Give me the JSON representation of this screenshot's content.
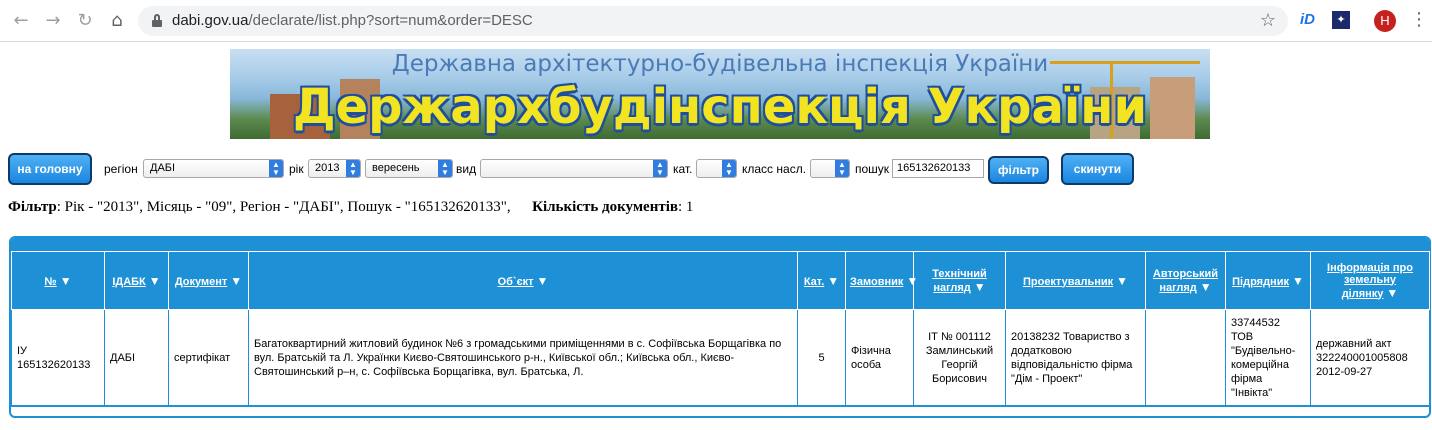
{
  "browser": {
    "url_host": "dabi.gov.ua",
    "url_path": "/declarate/list.php?sort=num&order=DESC",
    "ext1_label": "iD",
    "avatar_letter": "H"
  },
  "banner": {
    "subtitle": "Державна архітектурно-будівельна інспекція України",
    "title": "Держархбудінспекція України"
  },
  "filter_form": {
    "home_button": "на головну",
    "region_label": "регіон",
    "region_value": "ДАБІ",
    "year_label": "рік",
    "year_value": "2013",
    "month_value": "вересень",
    "type_label": "вид",
    "type_value": "",
    "cat_label": "кат.",
    "cat_value": "",
    "class_label": "класс насл.",
    "class_value": "",
    "search_label": "пошук",
    "search_value": "165132620133",
    "filter_button": "фільтр",
    "reset_button": "скинути"
  },
  "summary": {
    "filter_label": "Фільтр",
    "filter_text": ": Рік - \"2013\", Місяць - \"09\", Регіон - \"ДАБІ\", Пошук - \"165132620133\",",
    "count_label": "Кількість документів",
    "count_value": ": 1"
  },
  "table": {
    "headers": [
      {
        "label": "№",
        "sortable": true
      },
      {
        "label": "ІДАБК",
        "sortable": true
      },
      {
        "label": "Документ",
        "sortable": true
      },
      {
        "label": "Об`єкт",
        "sortable": true
      },
      {
        "label": "Кат.",
        "sortable": true
      },
      {
        "label": "Замовник",
        "sortable": true
      },
      {
        "label": "Технічний нагляд",
        "sortable": true
      },
      {
        "label": "Проектувальник",
        "sortable": true
      },
      {
        "label": "Авторський нагляд",
        "sortable": true
      },
      {
        "label": "Підрядник",
        "sortable": true
      },
      {
        "label": "Інформація про земельну ділянку",
        "sortable": true
      }
    ],
    "rows": [
      {
        "num": "ІУ 165132620133",
        "idabk": "ДАБІ",
        "document": "сертифікат",
        "object": "Багатоквартирний житловий будинок №6 з громадськими приміщеннями в с. Софіївська Борщагівка по вул. Братській та Л. Українки Києво-Святошинського р-н., Київської обл.; Київська обл., Києво-Святошинський р–н, с. Софіївська Борщагівка, вул. Братська, Л.",
        "category": "5",
        "customer": "Фізична особа",
        "tech_supervision": "ІТ № 001112 Замлинський Георгій Борисович",
        "designer": "20138232 Товариство з додатковою відповідальністю фірма \"Дім - Проект\"",
        "author_supervision": "",
        "contractor": "33744532 ТОВ \"Будівельно-комерційна фірма \"Інвікта\"",
        "land_info": "державний акт 322240001005808 2012-09-27"
      }
    ]
  },
  "colors": {
    "table_blue": "#1e90d6",
    "button_blue": "#1b86e0",
    "banner_title_yellow": "#f3e422"
  }
}
